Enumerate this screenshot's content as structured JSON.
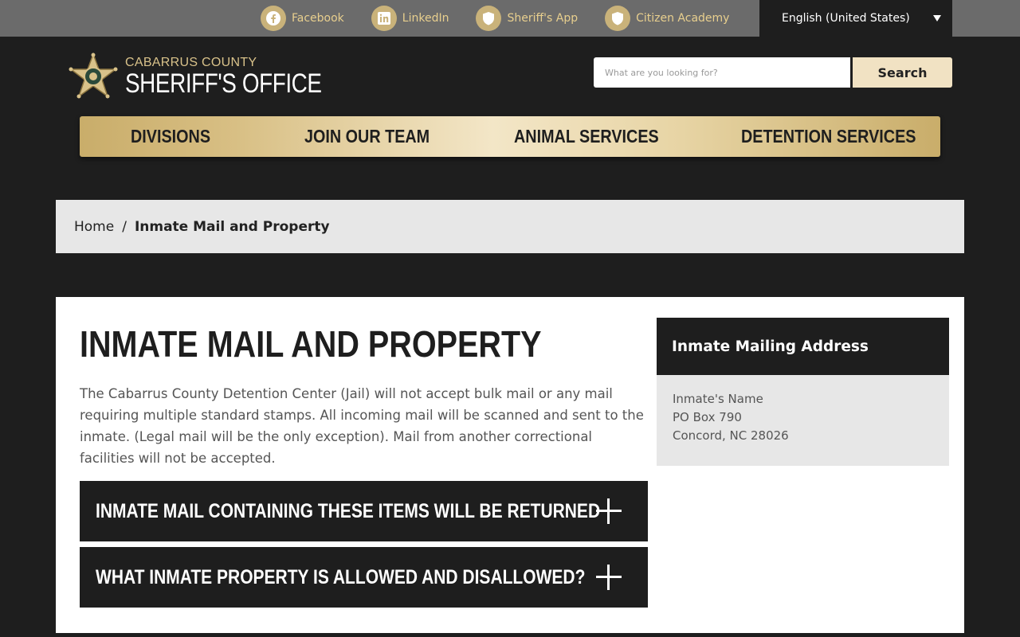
{
  "topbar": {
    "links": [
      {
        "label": "Facebook",
        "icon": "facebook-icon"
      },
      {
        "label": "LinkedIn",
        "icon": "linkedin-icon"
      },
      {
        "label": "Sheriff's App",
        "icon": "shield-icon"
      },
      {
        "label": "Citizen Academy",
        "icon": "shield-icon"
      }
    ],
    "language": "English (United States)"
  },
  "logo": {
    "county": "CABARRUS COUNTY",
    "office": "SHERIFF'S OFFICE"
  },
  "search": {
    "placeholder": "What are you looking for?",
    "button": "Search"
  },
  "nav": {
    "items": [
      "DIVISIONS",
      "JOIN OUR TEAM",
      "ANIMAL SERVICES",
      "DETENTION SERVICES"
    ]
  },
  "breadcrumb": {
    "home": "Home",
    "separator": "/",
    "current": "Inmate Mail and Property"
  },
  "main": {
    "title": "INMATE MAIL AND PROPERTY",
    "intro": "The Cabarrus County Detention Center (Jail) will not accept bulk mail or any mail requiring multiple standard stamps. All incoming mail will be scanned and sent to the inmate. (Legal mail will be the only exception). Mail from another correctional facilities will not be accepted.",
    "accordions": [
      "INMATE MAIL CONTAINING THESE ITEMS WILL BE RETURNED",
      "WHAT INMATE PROPERTY IS ALLOWED AND DISALLOWED?"
    ]
  },
  "sidebar": {
    "heading": "Inmate Mailing Address",
    "lines": [
      "Inmate's Name",
      "PO Box 790",
      "Concord, NC 28026"
    ]
  },
  "colors": {
    "dark": "#1e1e1e",
    "gold": "#c9ad6a",
    "topbar": "#6b6b6b",
    "light_panel": "#e7e7e7"
  }
}
